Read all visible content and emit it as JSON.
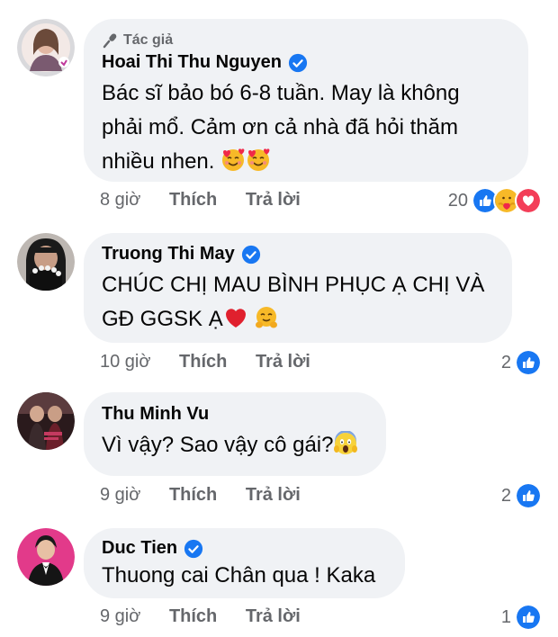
{
  "comments": [
    {
      "author_tag": "Tác giả",
      "author": "Hoai Thi Thu Nguyen",
      "verified": true,
      "text_line1": "Bác sĩ bảo bó 6-8 tuần. May là không",
      "text_line2": "phải mổ. Cảm ơn cả nhà đã hỏi thăm",
      "text_line3": "nhiều nhen.",
      "emoji": [
        "smiling-face-with-hearts",
        "smiling-face-with-hearts"
      ],
      "time": "8 giờ",
      "like_label": "Thích",
      "reply_label": "Trả lời",
      "reaction_count": "20",
      "reactions": [
        "like",
        "care",
        "love"
      ]
    },
    {
      "author": "Truong Thi May",
      "verified": true,
      "text_line1": "CHÚC CHỊ MAU BÌNH PHỤC Ạ CHỊ VÀ",
      "text_line2": "GĐ GGSK Ạ",
      "emoji": [
        "red-heart",
        "hugging-face"
      ],
      "time": "10 giờ",
      "like_label": "Thích",
      "reply_label": "Trả lời",
      "reaction_count": "2",
      "reactions": [
        "like"
      ]
    },
    {
      "author": "Thu Minh Vu",
      "verified": false,
      "text_line1": "Vì vậy? Sao vậy cô gái?",
      "emoji": [
        "face-screaming-in-fear"
      ],
      "time": "9 giờ",
      "like_label": "Thích",
      "reply_label": "Trả lời",
      "reaction_count": "2",
      "reactions": [
        "like"
      ]
    },
    {
      "author": "Duc Tien",
      "verified": true,
      "text_line1": "Thuong cai Chân qua ! Kaka",
      "time": "9 giờ",
      "like_label": "Thích",
      "reply_label": "Trả lời",
      "reaction_count": "1",
      "reactions": [
        "like"
      ]
    }
  ],
  "colors": {
    "bubble": "#f0f2f5",
    "meta_text": "#65676b",
    "verified": "#1877f2",
    "like": "#1877f2",
    "love": "#f33e58",
    "care": "#f7b928"
  }
}
